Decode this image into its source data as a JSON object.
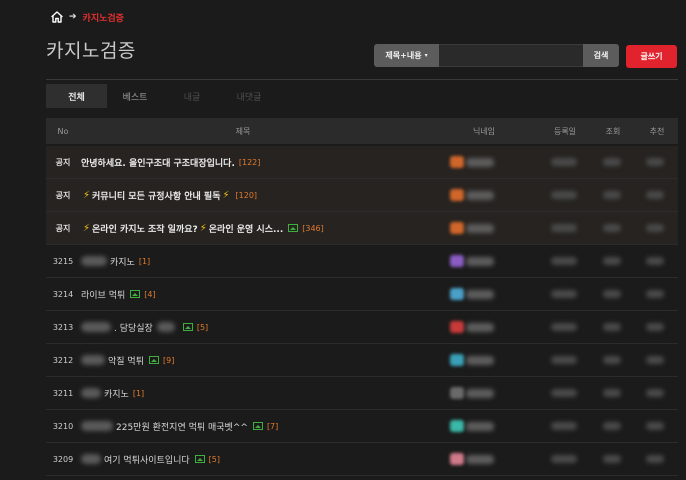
{
  "breadcrumb": {
    "home_icon": "home-icon",
    "arrow": "➔",
    "current": "카지노검증"
  },
  "page_title": "카지노검증",
  "search": {
    "select_label": "제목+내용",
    "caret": "▾",
    "input_value": "",
    "button_label": "검색"
  },
  "write_button": "글쓰기",
  "tabs": [
    {
      "label": "전체",
      "active": true
    },
    {
      "label": "베스트",
      "active": false
    },
    {
      "label": "내글",
      "active": false
    },
    {
      "label": "내댓글",
      "active": false
    }
  ],
  "table": {
    "headers": {
      "no": "No",
      "title": "제목",
      "nick": "닉네임",
      "date": "등록일",
      "views": "조회",
      "recommend": "추천"
    },
    "rows": [
      {
        "no": "공지",
        "notice": true,
        "pre": "",
        "lead_bolt": false,
        "title": "안녕하세요. 올인구조대 구조대장입니다.",
        "mid_bolt": false,
        "tail": "",
        "trail_bolt": false,
        "image": false,
        "count": "[122]",
        "avatar": "#d0662a"
      },
      {
        "no": "공지",
        "notice": true,
        "pre": "",
        "lead_bolt": true,
        "title": "커뮤니티 모든 규정사항 안내 필독",
        "mid_bolt": false,
        "tail": "",
        "trail_bolt": true,
        "image": false,
        "count": "[120]",
        "avatar": "#d0662a"
      },
      {
        "no": "공지",
        "notice": true,
        "pre": "",
        "lead_bolt": true,
        "title": "온라인 카지노 조작 일까요?",
        "mid_bolt": true,
        "tail": "온라인 운영 시스...",
        "trail_bolt": false,
        "image": true,
        "count": "[346]",
        "avatar": "#d0662a"
      },
      {
        "no": "3215",
        "notice": false,
        "pre": "blur",
        "lead_bolt": false,
        "title": "카지노",
        "mid_bolt": false,
        "tail": "",
        "trail_bolt": false,
        "image": false,
        "count": "[1]",
        "avatar": "#8a5cc4"
      },
      {
        "no": "3214",
        "notice": false,
        "pre": "",
        "lead_bolt": false,
        "title": "라이브 먹튀",
        "mid_bolt": false,
        "tail": "",
        "trail_bolt": false,
        "image": true,
        "count": "[4]",
        "avatar": "#4aa0c8"
      },
      {
        "no": "3213",
        "notice": false,
        "pre": "blur",
        "lead_bolt": false,
        "title": ". 담당실장",
        "mid_bolt": false,
        "tail": "",
        "trail_bolt": false,
        "image": true,
        "count": "[5]",
        "avatar": "#c83a3a",
        "post_blur": true
      },
      {
        "no": "3212",
        "notice": false,
        "pre": "blur",
        "lead_bolt": false,
        "title": "악질 먹튀",
        "mid_bolt": false,
        "tail": "",
        "trail_bolt": false,
        "image": true,
        "count": "[9]",
        "avatar": "#3aa0b8"
      },
      {
        "no": "3211",
        "notice": false,
        "pre": "blur",
        "lead_bolt": false,
        "title": "카지노",
        "mid_bolt": false,
        "tail": "",
        "trail_bolt": false,
        "image": false,
        "count": "[1]",
        "avatar": "#6a6a6a"
      },
      {
        "no": "3210",
        "notice": false,
        "pre": "blur",
        "lead_bolt": false,
        "title": "225만원 환전지연 먹튀 매국벳^^",
        "mid_bolt": false,
        "tail": "",
        "trail_bolt": false,
        "image": true,
        "count": "[7]",
        "avatar": "#3ab8a8"
      },
      {
        "no": "3209",
        "notice": false,
        "pre": "blur",
        "lead_bolt": false,
        "title": "여기 먹튀사이트입니다",
        "mid_bolt": false,
        "tail": "",
        "trail_bolt": false,
        "image": true,
        "count": "[5]",
        "avatar": "#d07a8a"
      }
    ]
  }
}
